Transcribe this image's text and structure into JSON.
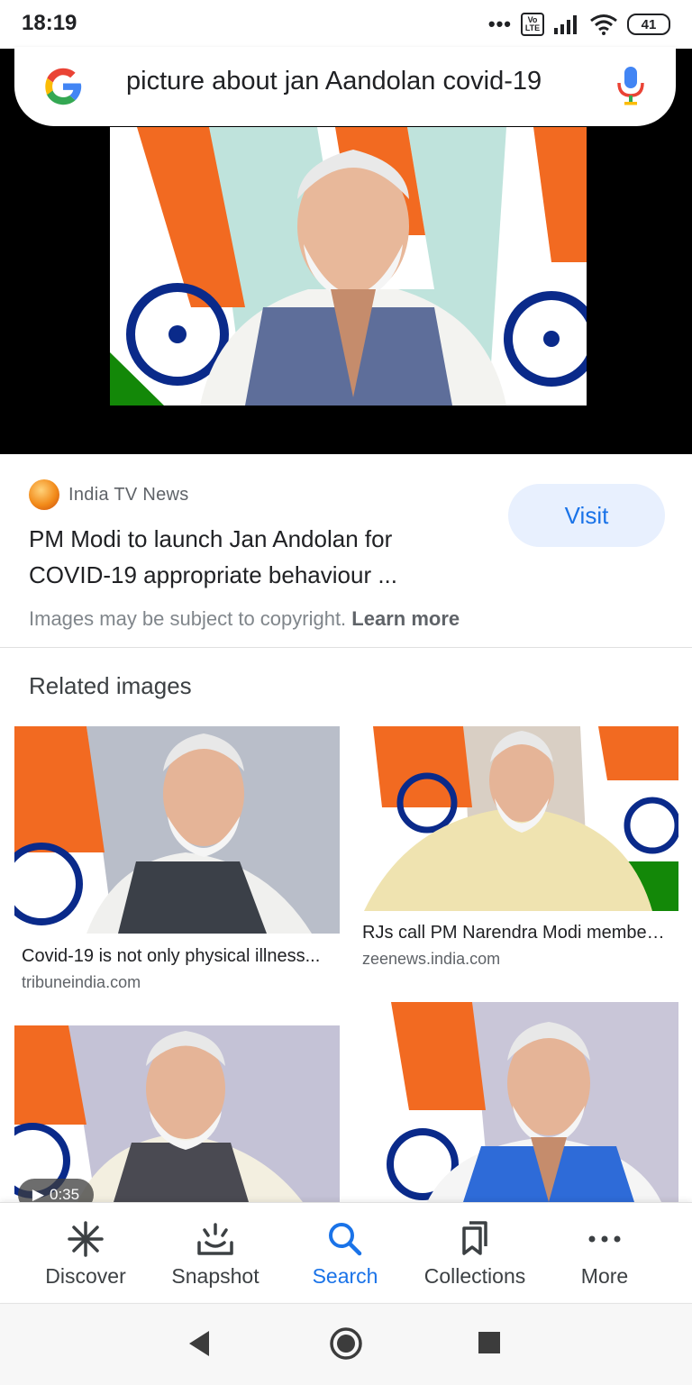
{
  "status_bar": {
    "time": "18:19",
    "dots": "•••",
    "volte": "Vo LTE",
    "battery": "41"
  },
  "search": {
    "query": "picture about jan Aandolan covid-19"
  },
  "result": {
    "source": "India TV News",
    "title": "PM Modi to launch Jan Andolan for COVID-19 appropriate behaviour ...",
    "visit_label": "Visit",
    "copyright_text": "Images may be subject to copyright.",
    "learn_more": "Learn more"
  },
  "related": {
    "heading": "Related images",
    "items": [
      {
        "caption": "Covid-19 is not only physical illness...",
        "domain": "tribuneindia.com"
      },
      {
        "caption": "RJs call PM Narendra Modi members...",
        "domain": "zeenews.india.com"
      },
      {
        "duration": "0:35"
      }
    ]
  },
  "bottom_nav": {
    "items": [
      {
        "label": "Discover",
        "icon": "discover-icon"
      },
      {
        "label": "Snapshot",
        "icon": "snapshot-icon"
      },
      {
        "label": "Search",
        "icon": "search-icon"
      },
      {
        "label": "Collections",
        "icon": "collections-icon"
      },
      {
        "label": "More",
        "icon": "more-icon"
      }
    ],
    "active": "Search"
  },
  "colors": {
    "accent": "#1a73e8",
    "visit_bg": "#e8f0fe",
    "saffron": "#f26a21",
    "india_green": "#138808",
    "chakra_blue": "#0a2a8a"
  }
}
